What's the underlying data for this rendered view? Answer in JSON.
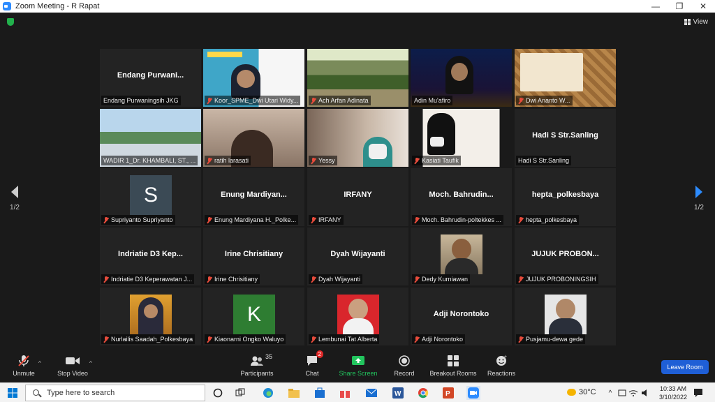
{
  "window": {
    "title": "Zoom Meeting - R Rapat",
    "minimize": "—",
    "restore": "❐",
    "close": "✕"
  },
  "view_label": "View",
  "page_indicator": {
    "left": "1/2",
    "right": "1/2"
  },
  "colors": {
    "accent": "#2D8CFF",
    "active_speaker": "#d8e07a",
    "muted": "#e74c3c",
    "leave": "#1f5fd6"
  },
  "tiles": [
    {
      "display": "Endang  Purwani...",
      "label": "Endang Purwaningsih JKG",
      "muted": false
    },
    {
      "display": "",
      "label": "Koor_SPME_Dwi Utari Widy...",
      "muted": true
    },
    {
      "display": "",
      "label": "Ach Arfan Adinata",
      "muted": true
    },
    {
      "display": "",
      "label": "Adin Mu'afiro",
      "muted": false,
      "active": true
    },
    {
      "display": "",
      "label": "Dwi Ananto W...",
      "muted": true
    },
    {
      "display": "",
      "label": "WADIR 1_Dr. KHAMBALI, ST., ...",
      "muted": false
    },
    {
      "display": "",
      "label": "ratih larasati",
      "muted": true
    },
    {
      "display": "",
      "label": "Yessy",
      "muted": true
    },
    {
      "display": "",
      "label": "Kasiati Taufik",
      "muted": true
    },
    {
      "display": "Hadi S Str.Sanling",
      "label": "Hadi S Str.Sanling",
      "muted": false
    },
    {
      "display": "",
      "avatar_letter": "S",
      "label": "Supriyanto Supriyanto",
      "muted": true
    },
    {
      "display": "Enung  Mardiyan...",
      "label": "Enung Mardiyana H._Polke...",
      "muted": true
    },
    {
      "display": "IRFANY",
      "label": "IRFANY",
      "muted": true
    },
    {
      "display": "Moch.  Bahrudin...",
      "label": "Moch. Bahrudin-poltekkes ...",
      "muted": true
    },
    {
      "display": "hepta_polkesbaya",
      "label": "hepta_polkesbaya",
      "muted": true
    },
    {
      "display": "Indriatie  D3  Kep...",
      "label": "Indriatie D3 Keperawatan J...",
      "muted": true
    },
    {
      "display": "Irine Chrisitiany",
      "label": "Irine Chrisitiany",
      "muted": true
    },
    {
      "display": "Dyah Wijayanti",
      "label": "Dyah Wijayanti",
      "muted": true
    },
    {
      "display": "",
      "label": "Dedy Kurniawan",
      "muted": true
    },
    {
      "display": "JUJUK  PROBON...",
      "label": "JUJUK PROBONINGSIH",
      "muted": true
    },
    {
      "display": "",
      "label": "Nurlailis Saadah_Polkesbaya",
      "muted": true
    },
    {
      "display": "",
      "avatar_letter": "K",
      "label": "Kiaonarni Ongko Waluyo",
      "muted": true
    },
    {
      "display": "",
      "label": "Lembunai Tat Alberta",
      "muted": true
    },
    {
      "display": "Adji Norontoko",
      "label": "Adji Norontoko",
      "muted": true
    },
    {
      "display": "",
      "label": "Pusjamu-dewa gede",
      "muted": true
    }
  ],
  "toolbar": {
    "unmute": "Unmute",
    "stop_video": "Stop Video",
    "participants": "Participants",
    "participants_count": "35",
    "chat": "Chat",
    "chat_badge": "2",
    "share_screen": "Share Screen",
    "record": "Record",
    "breakout_rooms": "Breakout Rooms",
    "reactions": "Reactions",
    "leave_room": "Leave Room"
  },
  "taskbar": {
    "search_placeholder": "Type here to search",
    "temperature": "30°C",
    "time": "10:33 AM",
    "date": "3/10/2022"
  }
}
